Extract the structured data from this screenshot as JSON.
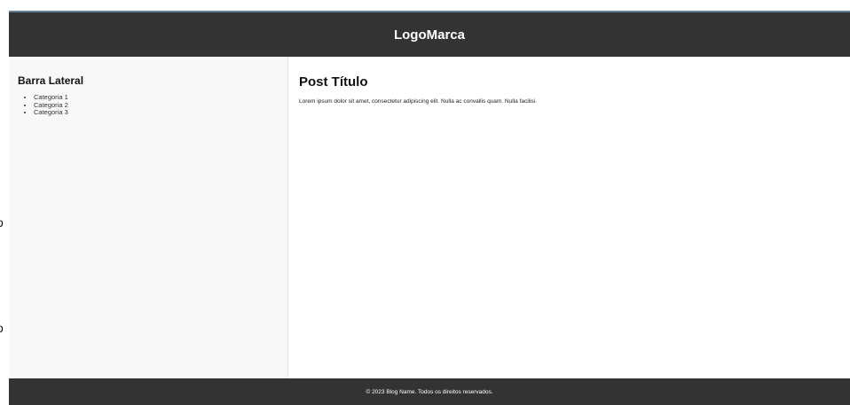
{
  "header": {
    "logo_text": "LogoMarca"
  },
  "sidebar": {
    "title": "Barra Lateral",
    "items": [
      {
        "label": "Categoria 1"
      },
      {
        "label": "Categoria 2"
      },
      {
        "label": "Categoria 3"
      }
    ]
  },
  "post": {
    "title": "Post Título",
    "body": "Lorem ipsum dolor sit amet, consectetur adipiscing elit. Nulla ac convallis quam. Nulla facilisi."
  },
  "footer": {
    "text": "© 2023 Blog Name. Todos os direitos reservados."
  },
  "edge_glyphs": [
    "o",
    "o"
  ],
  "colors": {
    "header_bg": "#333333",
    "sidebar_bg": "#f8f8f8",
    "footer_bg": "#333333",
    "text_light": "#ffffff"
  }
}
